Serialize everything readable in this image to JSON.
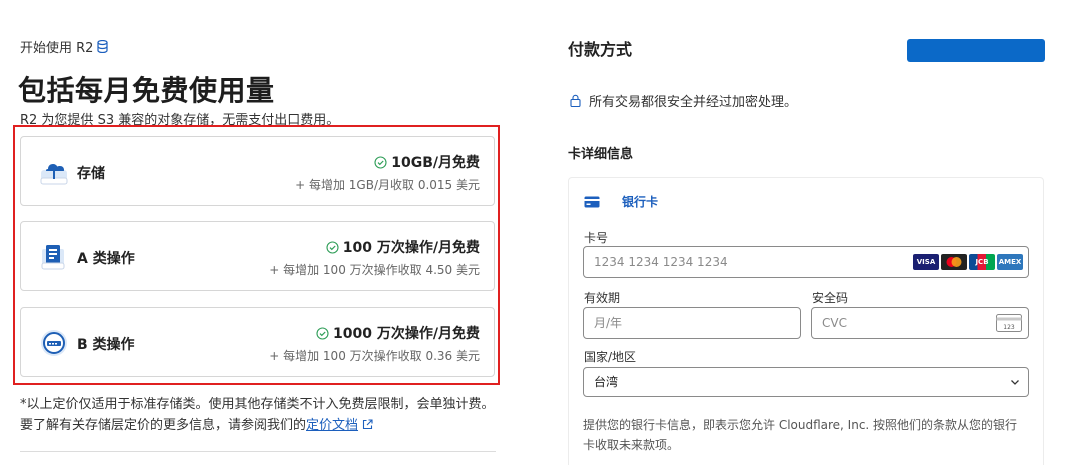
{
  "breadcrumb": {
    "label": "开始使用 R2",
    "icon": "database-icon"
  },
  "page_title": "包括每月免费使用量",
  "subtitle": "R2 为您提供 S3 兼容的对象存储，无需支付出口费用。",
  "tiers": [
    {
      "name": "存储",
      "free": "10GB/月免费",
      "extra": "+ 每增加 1GB/月收取 0.015 美元",
      "icon": "cloud-storage-icon"
    },
    {
      "name": "A 类操作",
      "free": "100 万次操作/月免费",
      "extra": "+ 每增加 100 万次操作收取 4.50 美元",
      "icon": "class-a-operations-icon"
    },
    {
      "name": "B 类操作",
      "free": "1000 万次操作/月免费",
      "extra": "+ 每增加 100 万次操作收取 0.36 美元",
      "icon": "class-b-operations-icon"
    }
  ],
  "footnote": {
    "text": "*以上定价仅适用于标准存储类。使用其他存储类不计入免费层限制，会单独计费。要了解有关存储层定价的更多信息，请参阅我们的",
    "link": "定价文档"
  },
  "payment": {
    "title": "付款方式",
    "secure_text": "所有交易都很安全并经过加密处理。",
    "card_details_title": "卡详细信息",
    "tab_label": "银行卡",
    "card_number_label": "卡号",
    "card_number_placeholder": "1234 1234 1234 1234",
    "expiry_label": "有效期",
    "expiry_placeholder": "月/年",
    "cvc_label": "安全码",
    "cvc_placeholder": "CVC",
    "country_label": "国家/地区",
    "country_value": "台湾",
    "consent": "提供您的银行卡信息，即表示您允许 Cloudflare, Inc. 按照他们的条款从您的银行卡收取未来款项。",
    "brands": [
      "VISA",
      "mastercard",
      "JCB",
      "AMEX"
    ],
    "cvc_icon_text": "123"
  },
  "colors": {
    "accent": "#0b69c8",
    "link": "#1c5fbd",
    "highlight_border": "#e02020",
    "check": "#2e9d57"
  }
}
